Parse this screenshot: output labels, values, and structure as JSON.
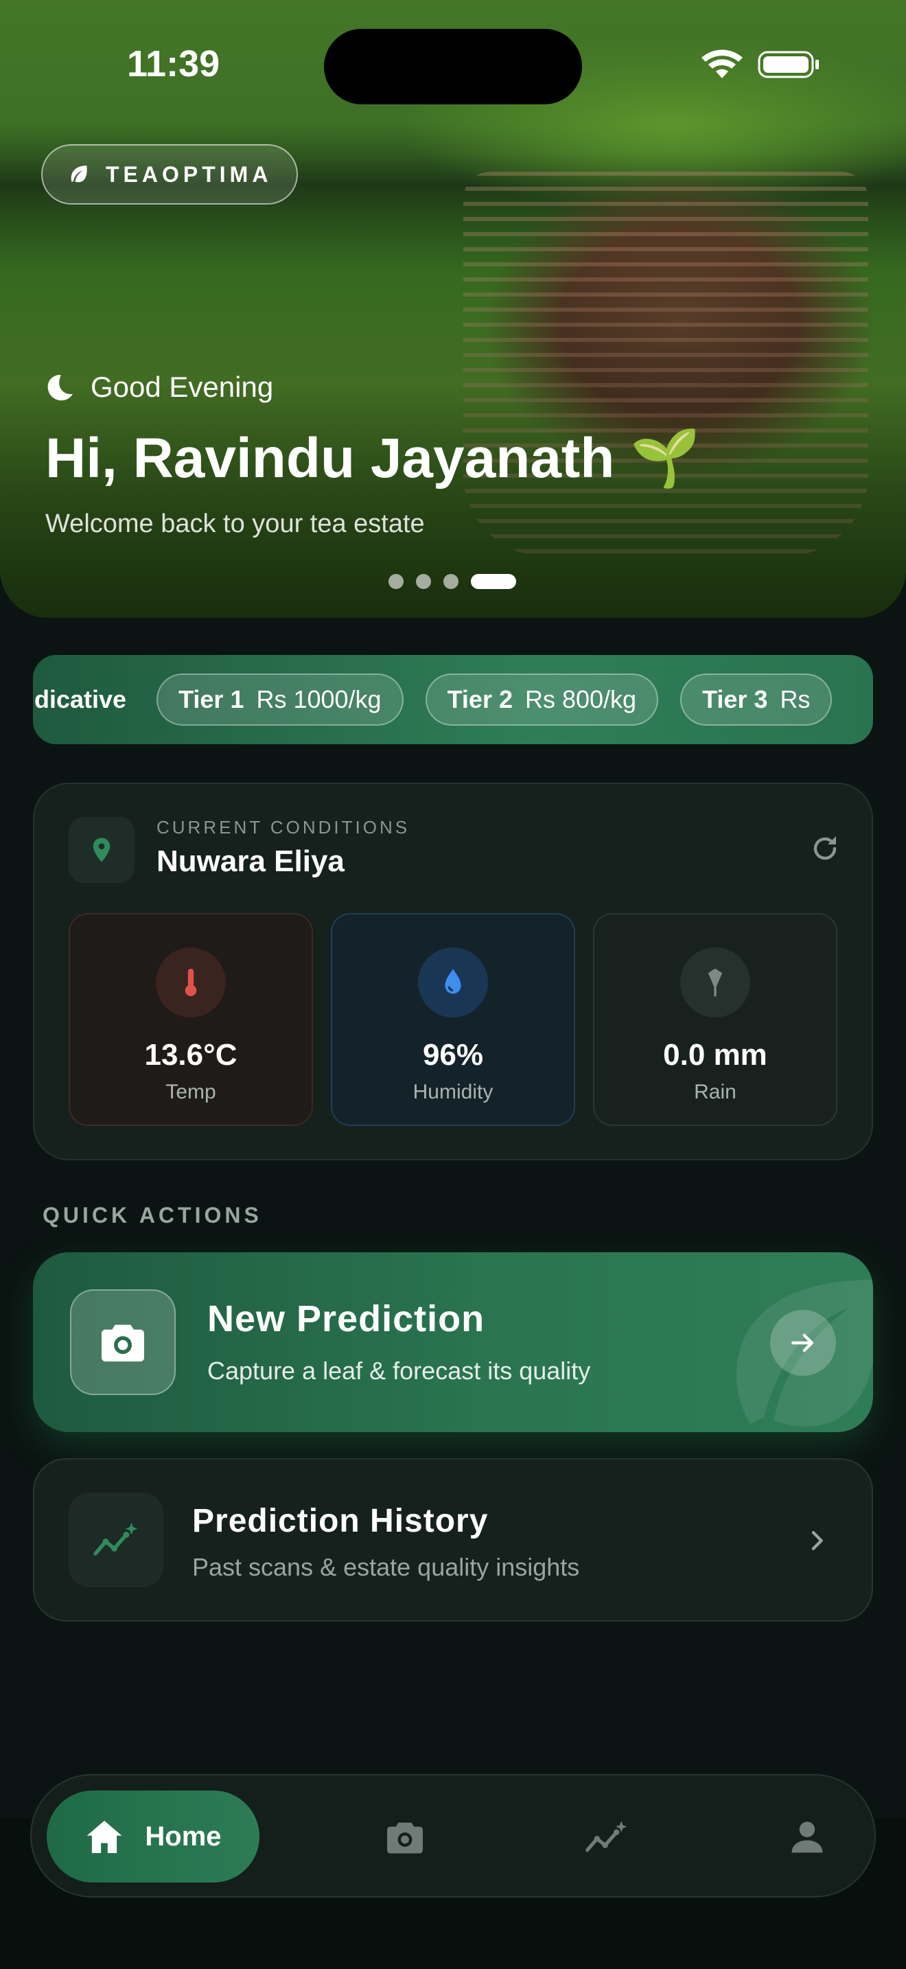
{
  "status_bar": {
    "time": "11:39"
  },
  "hero": {
    "brand": "TEAOPTIMA",
    "greeting": "Good Evening",
    "title": "Hi, Ravindu Jayanath 🌱",
    "subtitle": "Welcome back to your tea estate",
    "carousel_dots": 4,
    "carousel_active_index": 3
  },
  "price_ticker": {
    "label": "ndicative",
    "tiers": [
      {
        "name": "Tier 1",
        "price": "Rs 1000/kg"
      },
      {
        "name": "Tier 2",
        "price": "Rs 800/kg"
      },
      {
        "name": "Tier 3",
        "price": "Rs"
      }
    ]
  },
  "conditions": {
    "label": "CURRENT CONDITIONS",
    "location": "Nuwara Eliya",
    "metrics": [
      {
        "value": "13.6°C",
        "label": "Temp",
        "icon": "thermometer-icon",
        "color": "#e0524a"
      },
      {
        "value": "96%",
        "label": "Humidity",
        "icon": "water-drop-icon",
        "color": "#3d8ef0"
      },
      {
        "value": "0.0 mm",
        "label": "Rain",
        "icon": "umbrella-closed-icon",
        "color": "#7d8984"
      }
    ]
  },
  "quick_actions": {
    "title": "QUICK ACTIONS",
    "new_prediction": {
      "title": "New Prediction",
      "subtitle": "Capture a leaf & forecast its quality"
    },
    "history": {
      "title": "Prediction History",
      "subtitle": "Past scans & estate quality insights"
    }
  },
  "tab_bar": {
    "home_label": "Home",
    "tabs": [
      "home-icon",
      "camera-icon",
      "analytics-icon",
      "profile-icon"
    ]
  },
  "colors": {
    "accent": "#2d7c56",
    "background": "#0b1412",
    "card": "#16201d"
  }
}
